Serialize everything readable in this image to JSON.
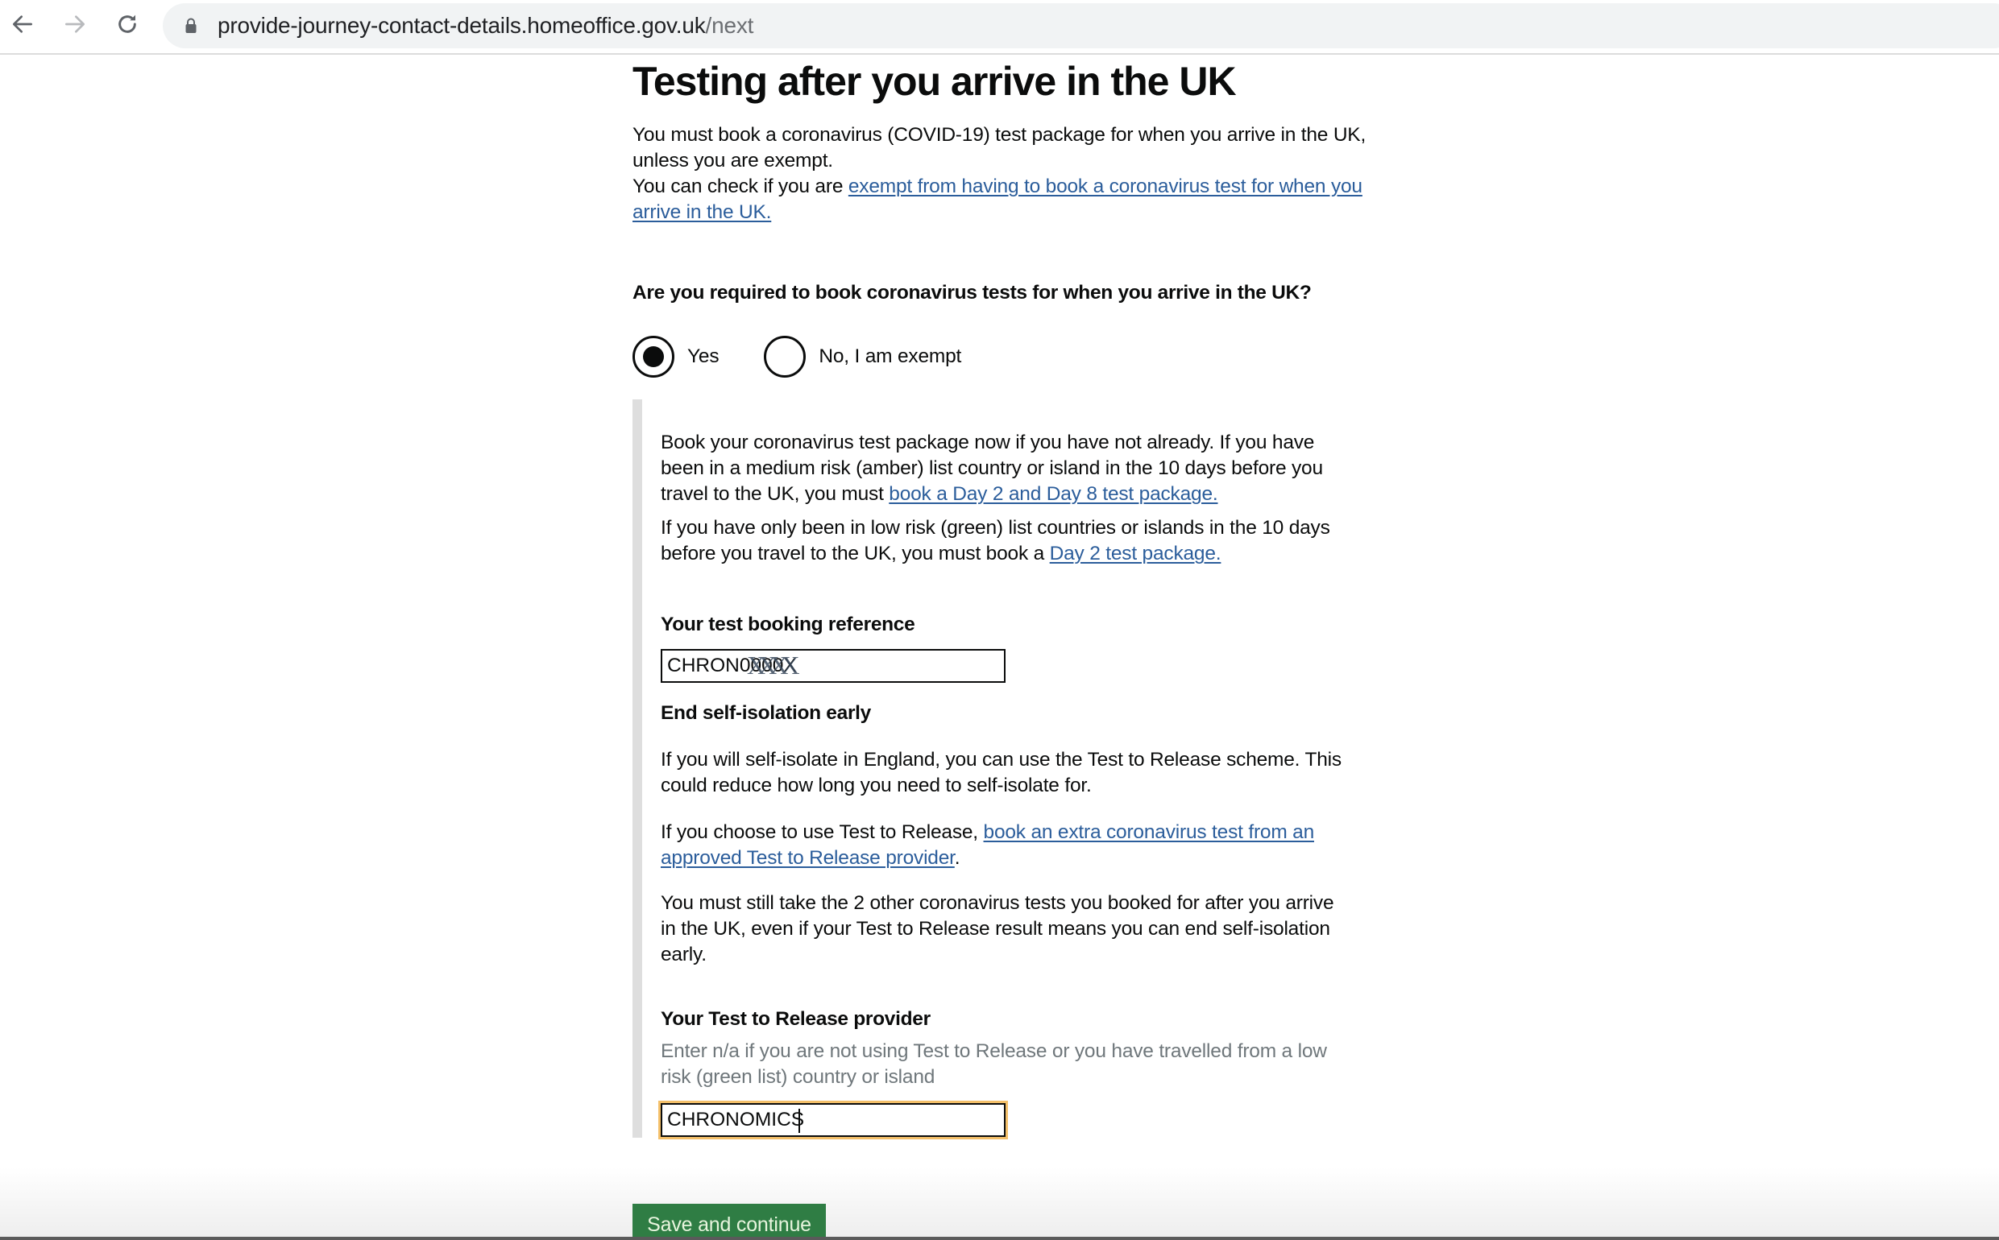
{
  "browser": {
    "url_host": "provide-journey-contact-details.homeoffice.gov.uk",
    "url_path": "/next",
    "icons": {
      "back": "arrow-left",
      "forward": "arrow-right",
      "reload": "reload",
      "secure": "lock"
    }
  },
  "page": {
    "title": "Testing after you arrive in the UK",
    "intro": "You must book a coronavirus (COVID-19) test package for when you arrive in the UK, unless you are exempt.",
    "exempt_check": {
      "prefix": "You can check if you are ",
      "link": "exempt from having to book a coronavirus test for when you arrive in the UK."
    },
    "question": "Are you required to book coronavirus tests for when you arrive in the UK?",
    "radios": [
      {
        "label": "Yes",
        "selected": true
      },
      {
        "label": "No, I am exempt",
        "selected": false
      }
    ],
    "conditional": {
      "amber": {
        "text": "Book your coronavirus test package now if you have not already. If you have been in a medium risk (amber) list country or island in the 10 days before you travel to the UK, you must ",
        "link": "book a Day 2 and Day 8 test package."
      },
      "green": {
        "text": "If you have only been in low risk (green) list countries or islands in the 10 days before you travel to the UK, you must book a ",
        "link": "Day 2 test package."
      },
      "booking_reference": {
        "label": "Your test booking reference",
        "value": "CHRON0000X",
        "redaction_overlay": "XXXX"
      },
      "end_isolation": {
        "heading": "End self-isolation early",
        "p1": "If you will self-isolate in England, you can use the Test to Release scheme. This could reduce how long you need to self-isolate for.",
        "p2_prefix": "If you choose to use Test to Release, ",
        "p2_link": "book an extra coronavirus test from an approved Test to Release provider",
        "p2_suffix": ".",
        "p3": "You must still take the 2 other coronavirus tests you booked for after you arrive in the UK, even if your Test to Release result means you can end self-isolation early."
      },
      "provider": {
        "label": "Your Test to Release provider",
        "hint": "Enter n/a if you are not using Test to Release or you have travelled from a low risk (green list) country or island",
        "value": "CHRONOMICS",
        "focused": true
      }
    },
    "submit_label": "Save and continue"
  },
  "colors": {
    "link": "#2b5d9b",
    "button": "#2f7d44",
    "focus": "#f4c06a",
    "inset_border": "#dedede",
    "text": "#0b0c0c"
  }
}
